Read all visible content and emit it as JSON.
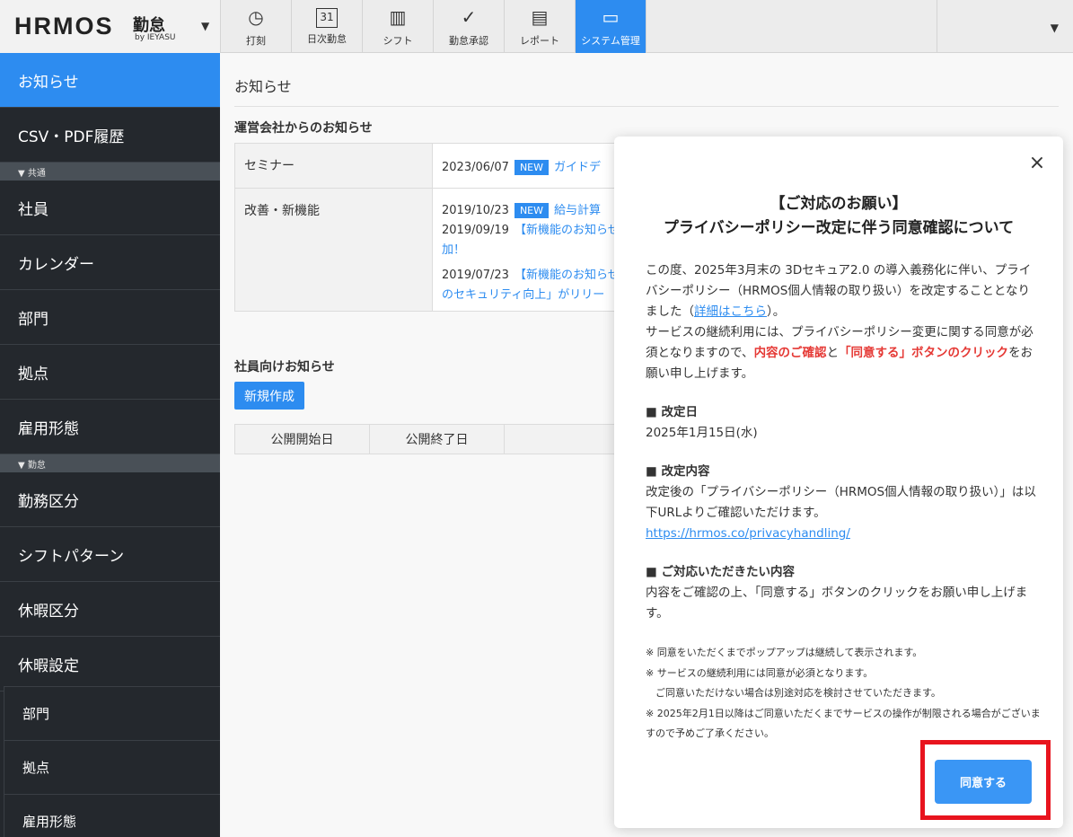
{
  "brand": {
    "name": "HRMOS",
    "product": "勤怠",
    "by": "by IEYASU"
  },
  "nav": [
    {
      "label": "打刻",
      "icon": "clock-icon",
      "glyph": "◷"
    },
    {
      "label": "日次勤怠",
      "icon": "calendar-icon",
      "glyph": "31"
    },
    {
      "label": "シフト",
      "icon": "notebook-icon",
      "glyph": "▥"
    },
    {
      "label": "勤怠承認",
      "icon": "check-icon",
      "glyph": "✓"
    },
    {
      "label": "レポート",
      "icon": "document-icon",
      "glyph": "▤"
    },
    {
      "label": "システム管理",
      "icon": "monitor-icon",
      "glyph": "▭"
    }
  ],
  "sidebar": {
    "items": [
      "お知らせ",
      "CSV・PDF履歴"
    ],
    "section_common": "▼ 共通",
    "common_items": [
      "社員",
      "カレンダー",
      "部門",
      "拠点",
      "雇用形態"
    ],
    "section_attendance": "▼ 勤怠",
    "attendance_items": [
      "勤務区分",
      "シフトパターン",
      "休暇区分",
      "休暇設定"
    ],
    "floating_items": [
      "部門",
      "拠点",
      "雇用形態"
    ]
  },
  "main": {
    "title": "お知らせ",
    "operator_news_title": "運営会社からのお知らせ",
    "news": [
      {
        "category": "セミナー",
        "entries": [
          {
            "date": "2023/06/07",
            "badge": "NEW",
            "text": "ガイドデ"
          }
        ]
      },
      {
        "category": "改善・新機能",
        "entries": [
          {
            "date": "2019/10/23",
            "badge": "NEW",
            "text": "給与計算"
          },
          {
            "date": "2019/09/19",
            "badge": "",
            "text": "【新機能のお知らせ"
          },
          {
            "date": "",
            "badge": "",
            "text": "加！"
          },
          {
            "date": "2019/07/23",
            "badge": "",
            "text": "【新機能のお知らせ"
          },
          {
            "date": "",
            "badge": "",
            "text": "のセキュリティ向上」がリリー"
          }
        ]
      }
    ],
    "employee_news_title": "社員向けお知らせ",
    "new_button": "新規作成",
    "employee_table_headers": [
      "公開開始日",
      "公開終了日"
    ]
  },
  "modal": {
    "title_line1": "【ご対応のお願い】",
    "title_line2": "プライバシーポリシー改定に伴う同意確認について",
    "p1_a": "この度、2025年3月末の 3Dセキュア2.0 の導入義務化に伴い、プライバシーポリシー（HRMOS個人情報の取り扱い）を改定することとなりました（",
    "p1_link": "詳細はこちら",
    "p1_b": "）。",
    "p2_a": "サービスの継続利用には、プライバシーポリシー変更に関する同意が必須となりますので、",
    "p2_red1": "内容のご確認",
    "p2_b": "と",
    "p2_red2": "「同意する」ボタンのクリック",
    "p2_c": "をお願い申し上げます。",
    "h1": "■ 改定日",
    "d1": "2025年1月15日(水)",
    "h2": "■ 改定内容",
    "d2": "改定後の「プライバシーポリシー（HRMOS個人情報の取り扱い）」は以下URLよりご確認いただけます。",
    "url": "https://hrmos.co/privacyhandling/",
    "h3": "■ ご対応いただきたい内容",
    "d3": "内容をご確認の上、「同意する」ボタンのクリックをお願い申し上げます。",
    "notes": [
      "※ 同意をいただくまでポップアップは継続して表示されます。",
      "※ サービスの継続利用には同意が必須となります。",
      "　ご同意いただけない場合は別途対応を検討させていただきます。",
      "※ 2025年2月1日以降はご同意いただくまでサービスの操作が制限される場合がございますので予めご了承ください。"
    ],
    "agree_button": "同意する",
    "close_glyph": "×"
  },
  "colors": {
    "accent": "#2d8cf0",
    "sidebar": "#24282d",
    "highlight": "#e8141e",
    "emphasis": "#e53935"
  }
}
